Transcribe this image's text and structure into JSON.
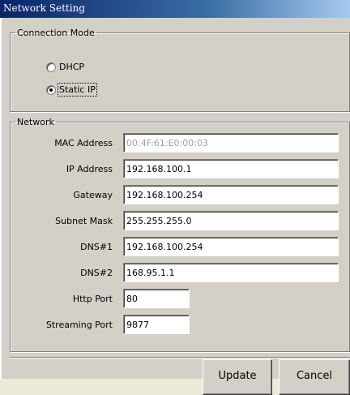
{
  "window": {
    "title": "Network Setting"
  },
  "connection_mode": {
    "legend": "Connection Mode",
    "options": [
      {
        "label": "DHCP",
        "selected": false
      },
      {
        "label": "Static IP",
        "selected": true
      }
    ]
  },
  "network": {
    "legend": "Network",
    "fields": [
      {
        "label": "MAC Address",
        "value": "00:4F:61:E0:00:03",
        "readonly": true
      },
      {
        "label": "IP Address",
        "value": "192.168.100.1"
      },
      {
        "label": "Gateway",
        "value": "192.168.100.254"
      },
      {
        "label": "Subnet Mask",
        "value": "255.255.255.0"
      },
      {
        "label": "DNS#1",
        "value": "192.168.100.254"
      },
      {
        "label": "DNS#2",
        "value": "168.95.1.1"
      },
      {
        "label": "Http Port",
        "value": "80"
      },
      {
        "label": "Streaming Port",
        "value": "9877"
      }
    ]
  },
  "buttons": {
    "update": "Update",
    "cancel": "Cancel"
  }
}
